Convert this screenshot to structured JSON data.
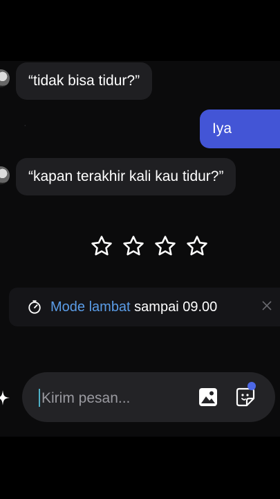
{
  "messages": [
    {
      "from": "bot",
      "text": "“tidak bisa tidur?”"
    },
    {
      "from": "user",
      "text": "Iya"
    },
    {
      "from": "bot",
      "text": "“kapan terakhir kali kau tidur?”"
    }
  ],
  "rating": {
    "stars": 4,
    "selected": 0
  },
  "slow_mode": {
    "label": "Mode lambat",
    "suffix": " sampai 09.00"
  },
  "composer": {
    "placeholder": "Kirim pesan..."
  },
  "colors": {
    "accent": "#4355d6",
    "link": "#5b9de8",
    "background": "#0b0b0c"
  }
}
